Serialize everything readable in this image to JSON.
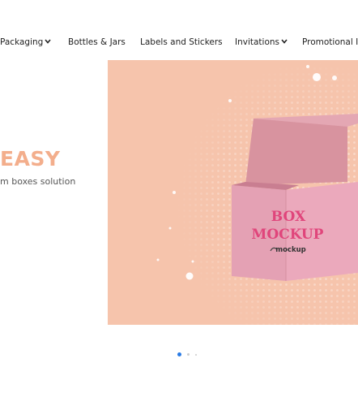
{
  "nav": {
    "items": [
      {
        "label": "Packaging",
        "has_dropdown": true
      },
      {
        "label": "Bottles & Jars",
        "has_dropdown": false
      },
      {
        "label": "Labels and Stickers",
        "has_dropdown": false
      },
      {
        "label": "Invitations",
        "has_dropdown": true
      },
      {
        "label": "Promotional It",
        "has_dropdown": false
      }
    ]
  },
  "hero": {
    "headline": "EASY",
    "subtext": "m boxes solution",
    "banner": {
      "box_line1": "BOX",
      "box_line2": "MOCKUP",
      "box_brand": "mockup"
    }
  },
  "carousel": {
    "slide_count": 3,
    "active_index": 0
  },
  "colors": {
    "banner_background": "#f6c4ac",
    "headline": "#f3ae8c",
    "box_front": "#ebaabd",
    "box_text": "#e0457b",
    "active_dot": "#2a7be4",
    "inactive_dot": "#cccccc"
  }
}
